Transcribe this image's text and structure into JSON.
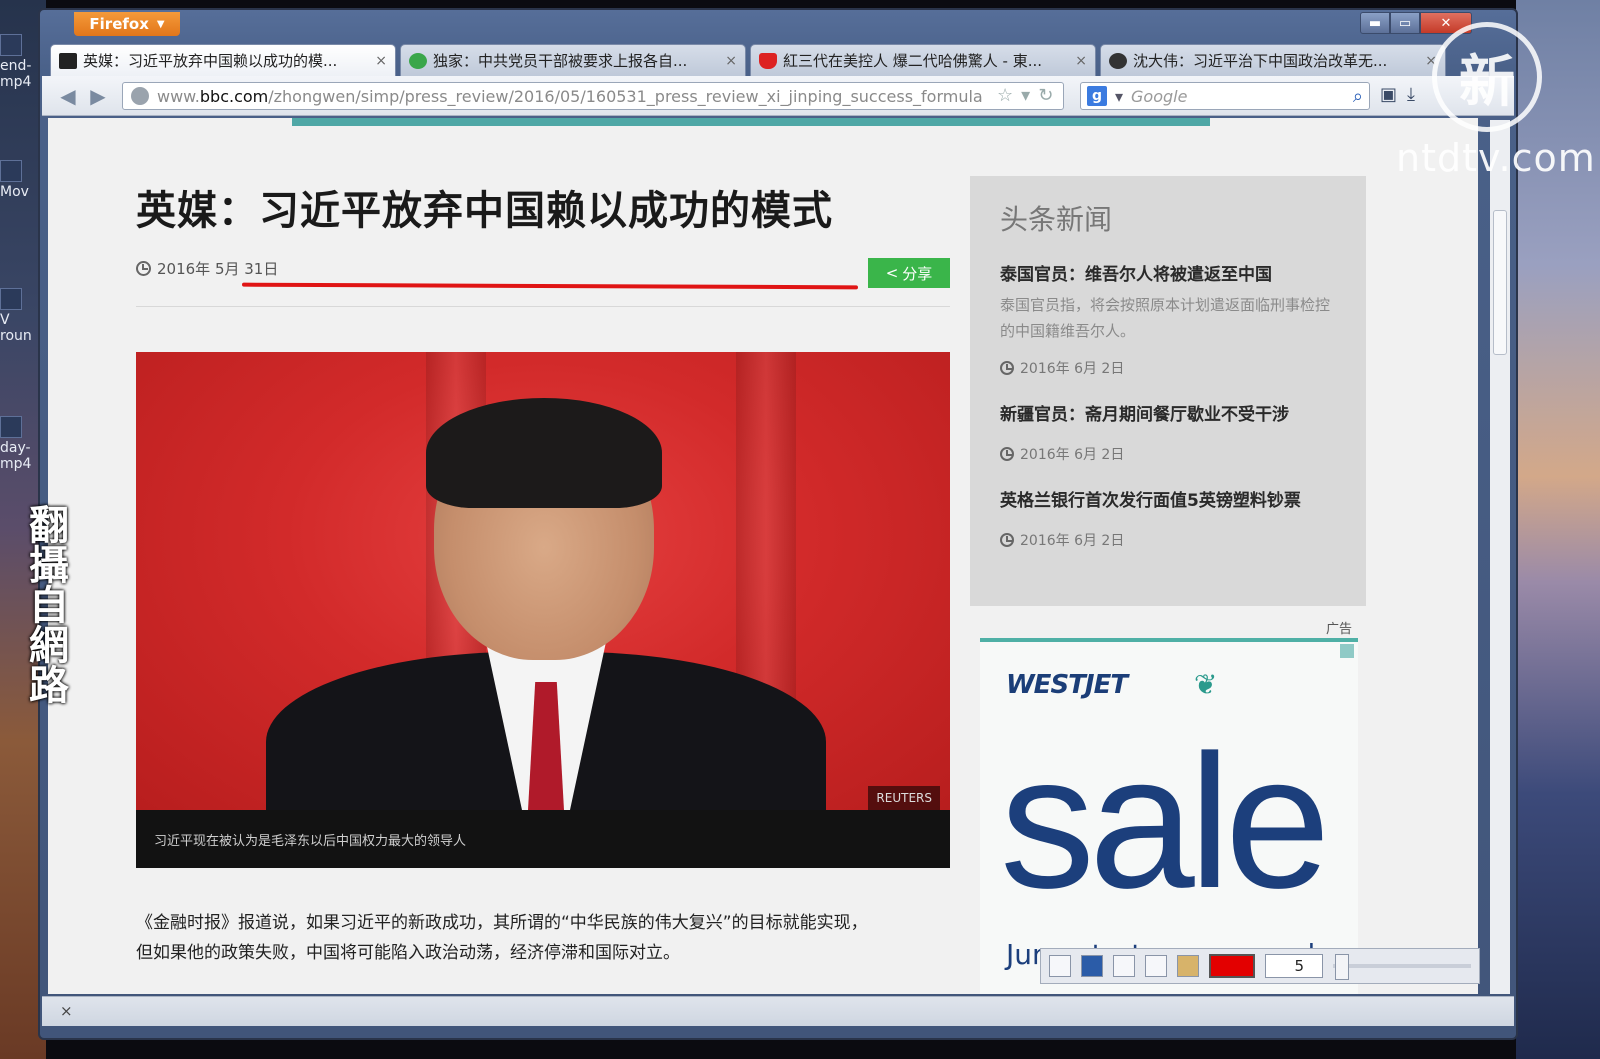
{
  "desktop": {
    "icons": [
      {
        "label": "end-\nmp4"
      },
      {
        "label": "Mov"
      },
      {
        "label": "V\nroun"
      },
      {
        "label": "day-\nmp4"
      }
    ]
  },
  "browser": {
    "app_button": "Firefox",
    "window_controls": {
      "minimize": "▬",
      "maximize": "▭",
      "close": "✕"
    },
    "tabs": [
      {
        "title": "英媒：习近平放弃中国赖以成功的模...",
        "active": true
      },
      {
        "title": "独家：中共党员干部被要求上报各自...",
        "active": false
      },
      {
        "title": "紅三代在美控人 爆二代哈佛驚人 - 東...",
        "active": false
      },
      {
        "title": "沈大伟：习近平治下中国政治改革无...",
        "active": false
      }
    ],
    "tab_close": "×",
    "url": {
      "domain_prefix": "www.",
      "domain": "bbc.com",
      "path": "/zhongwen/simp/press_review/2016/05/160531_press_review_xi_jinping_success_formula"
    },
    "search_placeholder": "Google",
    "search_engine_letter": "g"
  },
  "article": {
    "headline": "英媒：习近平放弃中国赖以成功的模式",
    "date": "2016年 5月 31日",
    "share_label": "分享",
    "photo_credit": "REUTERS",
    "photo_caption": "习近平现在被认为是毛泽东以后中国权力最大的领导人",
    "body": "《金融时报》报道说，如果习近平的新政成功，其所谓的“中华民族的伟大复兴”的目标就能实现，但如果他的政策失败，中国将可能陷入政治动荡，经济停滞和国际对立。"
  },
  "sidebar": {
    "title": "头条新闻",
    "stories": [
      {
        "title": "泰国官员：维吾尔人将被遣返至中国",
        "summary": "泰国官员指，将会按照原本计划遣返面临刑事检控的中国籍维吾尔人。",
        "date": "2016年 6月 2日"
      },
      {
        "title": "新疆官员：斋月期间餐厅歇业不受干涉",
        "summary": "",
        "date": "2016年 6月 2日"
      },
      {
        "title": "英格兰银行首次发行面值5英镑塑料钞票",
        "summary": "",
        "date": "2016年 6月 2日"
      }
    ]
  },
  "ad": {
    "label": "广告",
    "brand": "WESTJET",
    "headline": "sale",
    "tagline": "Jumpstart summer sale"
  },
  "recorder_toolbar": {
    "pen_size": "5"
  },
  "status_bar": {
    "close": "×"
  },
  "overlay": {
    "watermark_glyph": "新",
    "channel": "ntdtv.com",
    "vertical_caption": "翻攝自網路"
  },
  "colors": {
    "firefox_orange": "#e2761a",
    "share_green": "#3ab54a",
    "highlight_red": "#e01515",
    "westjet_navy": "#1c3f7c",
    "westjet_teal": "#4fb0a6"
  }
}
